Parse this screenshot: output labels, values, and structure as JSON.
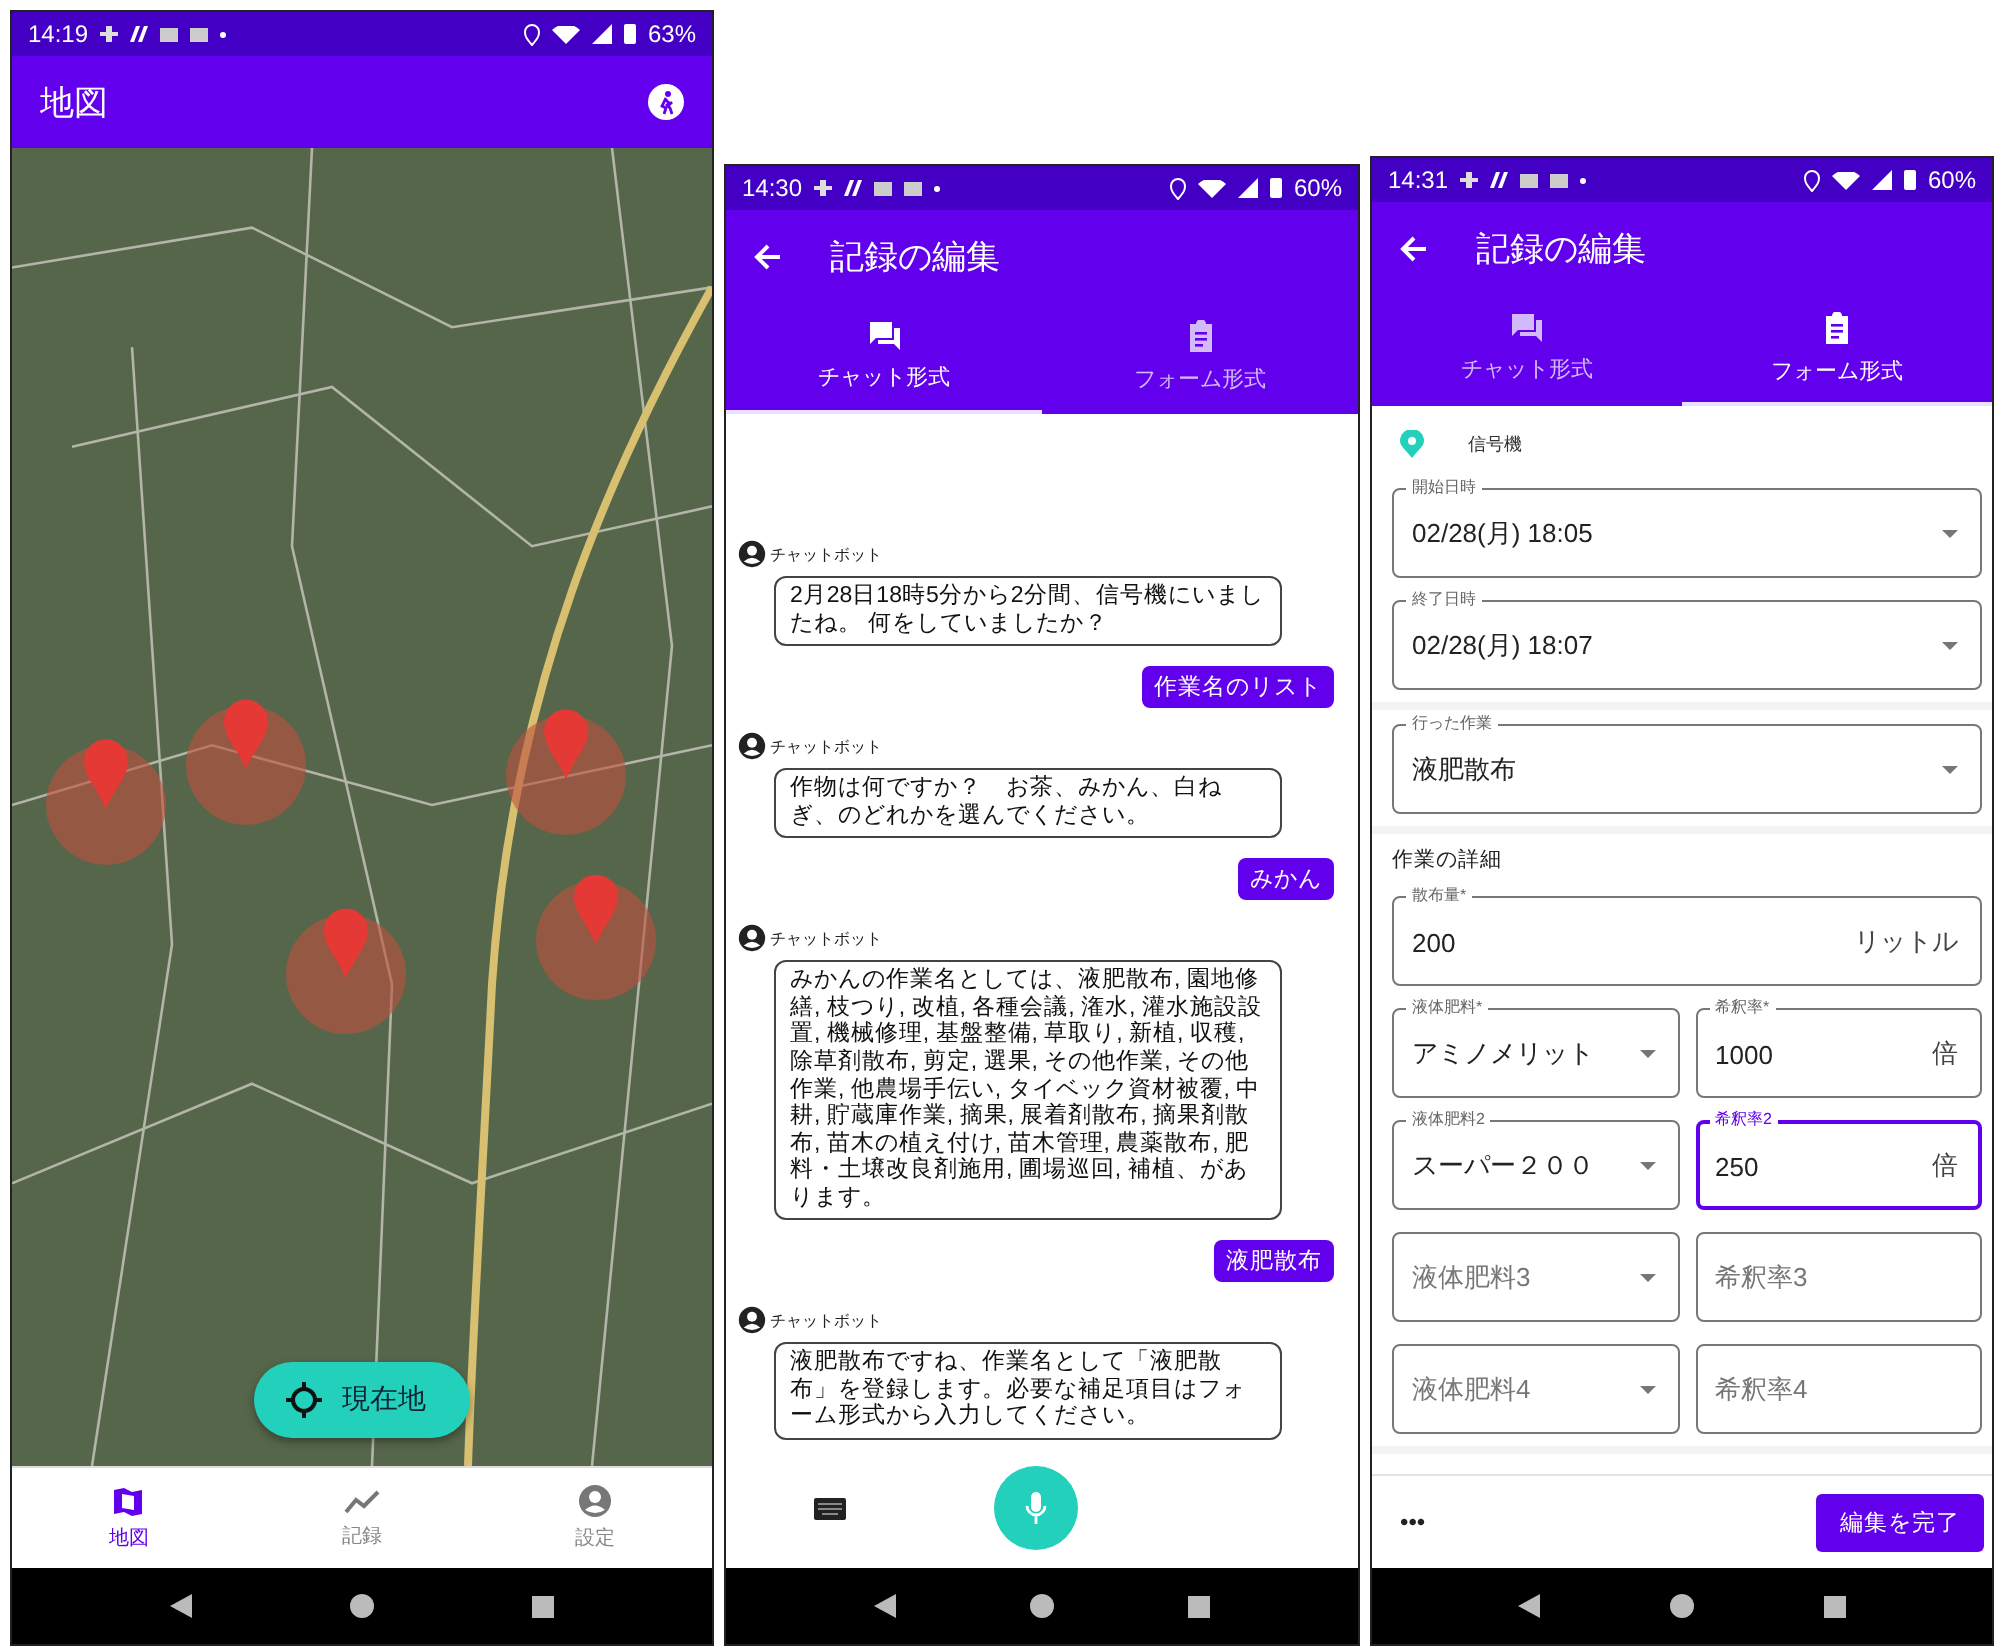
{
  "screens": [
    {
      "kind": "map",
      "status_bar": {
        "time": "14:19",
        "battery": "63%"
      },
      "app_bar": {
        "title": "地図"
      },
      "locate_button": "現在地",
      "bottom_nav": [
        {
          "label": "地図",
          "kind": "map",
          "selected": true
        },
        {
          "label": "記録",
          "kind": "chart",
          "selected": false
        },
        {
          "label": "設定",
          "kind": "account",
          "selected": false
        }
      ]
    },
    {
      "kind": "chat",
      "status_bar": {
        "time": "14:30",
        "battery": "60%"
      },
      "app_bar": {
        "title": "記録の編集"
      },
      "tabs": [
        {
          "label": "チャット形式",
          "kind": "chat",
          "selected": true
        },
        {
          "label": "フォーム形式",
          "kind": "form",
          "selected": false
        }
      ],
      "messages": [
        {
          "kind": "bot",
          "sender": "チャットボット",
          "text": "2月28日18時5分から2分間、信号機にいましたね。 何をしていましたか？"
        },
        {
          "kind": "user",
          "text": "作業名のリスト"
        },
        {
          "kind": "bot",
          "sender": "チャットボット",
          "text": "作物は何ですか？　お茶、みかん、白ねぎ、のどれかを選んでください。"
        },
        {
          "kind": "user",
          "text": "みかん"
        },
        {
          "kind": "bot",
          "sender": "チャットボット",
          "text": "みかんの作業名としては、液肥散布, 園地修繕, 枝つり, 改植, 各種会議, 潅水, 灌水施設設置, 機械修理, 基盤整備, 草取り, 新植, 収穫, 除草剤散布, 剪定, 選果, その他作業, その他作業, 他農場手伝い, タイベック資材被覆, 中耕, 貯蔵庫作業, 摘果, 展着剤散布, 摘果剤散布, 苗木の植え付け, 苗木管理, 農薬散布, 肥料・土壌改良剤施用, 圃場巡回, 補植、があります。"
        },
        {
          "kind": "user",
          "text": "液肥散布"
        },
        {
          "kind": "bot",
          "sender": "チャットボット",
          "text": "液肥散布ですね、作業名として「液肥散布」を登録します。必要な補足項目はフォーム形式から入力してください。"
        }
      ]
    },
    {
      "kind": "form",
      "status_bar": {
        "time": "14:31",
        "battery": "60%"
      },
      "app_bar": {
        "title": "記録の編集"
      },
      "tabs": [
        {
          "label": "チャット形式",
          "kind": "chat",
          "selected": false
        },
        {
          "label": "フォーム形式",
          "kind": "form",
          "selected": true
        }
      ],
      "location": "信号機",
      "sections": [
        {
          "rows": [
            [
              {
                "kind": "select",
                "label": "開始日時",
                "value": "02/28(月) 18:05",
                "focused": false
              }
            ],
            [
              {
                "kind": "select",
                "label": "終了日時",
                "value": "02/28(月) 18:07",
                "focused": false
              }
            ]
          ]
        },
        {
          "rows": [
            [
              {
                "kind": "select",
                "label": "行った作業",
                "value": "液肥散布",
                "focused": false
              }
            ]
          ]
        },
        {
          "title": "作業の詳細",
          "rows": [
            [
              {
                "kind": "input",
                "label": "散布量*",
                "value": "200",
                "unit": "リットル",
                "focused": false
              }
            ],
            [
              {
                "kind": "select",
                "label": "液体肥料*",
                "value": "アミノメリット",
                "focused": false
              },
              {
                "kind": "input",
                "label": "希釈率*",
                "value": "1000",
                "unit": "倍",
                "focused": false
              }
            ],
            [
              {
                "kind": "select",
                "label": "液体肥料2",
                "value": "スーパー２００",
                "focused": false
              },
              {
                "kind": "input",
                "label": "希釈率2",
                "value": "250",
                "unit": "倍",
                "focused": true
              }
            ],
            [
              {
                "kind": "select",
                "placeholder": "液体肥料3",
                "focused": false
              },
              {
                "kind": "input",
                "placeholder": "希釈率3",
                "focused": false
              }
            ],
            [
              {
                "kind": "select",
                "placeholder": "液体肥料4",
                "focused": false
              },
              {
                "kind": "input",
                "placeholder": "希釈率4",
                "focused": false
              }
            ]
          ]
        }
      ],
      "more_button": "•••",
      "done_button": "編集を完了"
    }
  ]
}
